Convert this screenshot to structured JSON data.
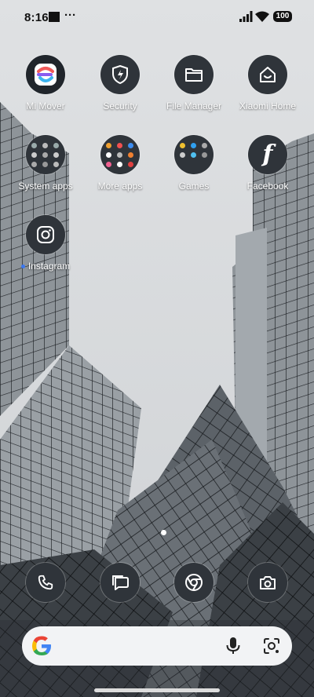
{
  "status_bar": {
    "time": "8:16",
    "more_indicator": "···",
    "battery": "100"
  },
  "apps": [
    {
      "id": "mi-mover",
      "label": "Mi Mover",
      "icon": "mi-mover-icon"
    },
    {
      "id": "security",
      "label": "Security",
      "icon": "shield-icon"
    },
    {
      "id": "file-manager",
      "label": "File Manager",
      "icon": "folder-icon"
    },
    {
      "id": "xiaomi-home",
      "label": "Xiaomi Home",
      "icon": "home-icon"
    },
    {
      "id": "system-apps",
      "label": "System apps",
      "icon": "folder-grid-icon"
    },
    {
      "id": "more-apps",
      "label": "More apps",
      "icon": "folder-grid-icon"
    },
    {
      "id": "games",
      "label": "Games",
      "icon": "folder-grid-icon"
    },
    {
      "id": "facebook",
      "label": "Facebook",
      "icon": "facebook-icon"
    },
    {
      "id": "instagram",
      "label": "Instagram",
      "icon": "instagram-icon"
    }
  ],
  "dock": [
    {
      "id": "phone",
      "icon": "phone-icon"
    },
    {
      "id": "messages",
      "icon": "messages-icon"
    },
    {
      "id": "chrome",
      "icon": "chrome-icon"
    },
    {
      "id": "camera",
      "icon": "camera-icon"
    }
  ],
  "search": {
    "icons": [
      "google-g-icon",
      "mic-icon",
      "lens-icon"
    ]
  },
  "colors": {
    "icon_bg": "#2f343a",
    "label": "#ffffff",
    "search_bg": "#f2f3f5"
  }
}
